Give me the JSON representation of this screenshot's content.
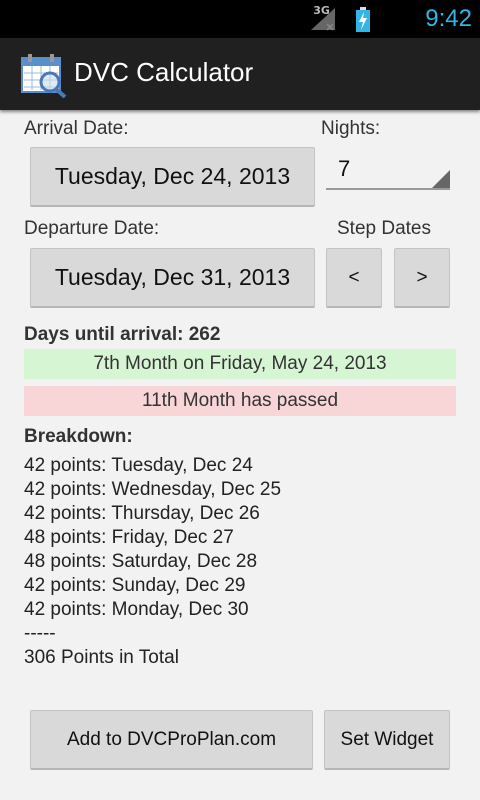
{
  "status_bar": {
    "network": "3G",
    "time": "9:42",
    "accent_color": "#33b5e5"
  },
  "action_bar": {
    "title": "DVC Calculator",
    "icon": "calendar-search-icon"
  },
  "form": {
    "arrival_label": "Arrival Date:",
    "arrival_value": "Tuesday, Dec 24, 2013",
    "nights_label": "Nights:",
    "nights_value": "7",
    "departure_label": "Departure Date:",
    "departure_value": "Tuesday, Dec 31, 2013",
    "step_label": "Step Dates",
    "prev_label": "<",
    "next_label": ">"
  },
  "info": {
    "days_until": "Days until arrival: 262",
    "seventh_month": "7th Month on Friday, May 24, 2013",
    "eleventh_month": "11th Month has passed",
    "green_color": "#d6f5d3",
    "red_color": "#f8d5d7"
  },
  "breakdown": {
    "title": "Breakdown:",
    "items": [
      "42 points: Tuesday, Dec 24",
      "42 points: Wednesday, Dec 25",
      "42 points: Thursday, Dec 26",
      "48 points: Friday, Dec 27",
      "48 points: Saturday, Dec 28",
      "42 points: Sunday, Dec 29",
      "42 points: Monday, Dec 30"
    ],
    "separator": "-----",
    "total": "306 Points in Total"
  },
  "buttons": {
    "add": "Add to DVCProPlan.com",
    "widget": "Set Widget"
  }
}
